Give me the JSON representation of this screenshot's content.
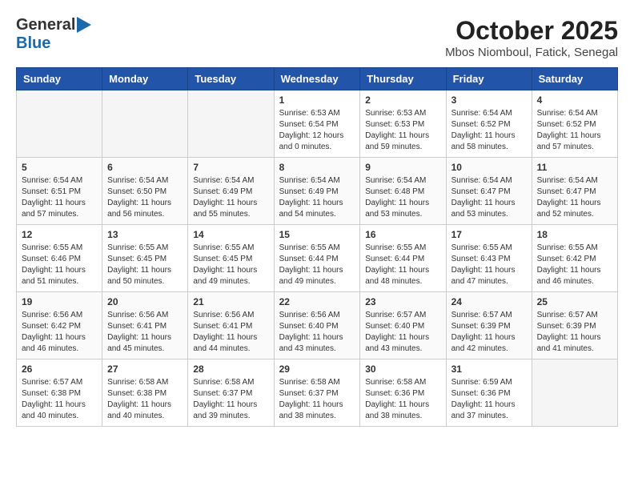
{
  "header": {
    "logo_general": "General",
    "logo_blue": "Blue",
    "title": "October 2025",
    "subtitle": "Mbos Niomboul, Fatick, Senegal"
  },
  "calendar": {
    "days_of_week": [
      "Sunday",
      "Monday",
      "Tuesday",
      "Wednesday",
      "Thursday",
      "Friday",
      "Saturday"
    ],
    "weeks": [
      [
        {
          "day": "",
          "info": ""
        },
        {
          "day": "",
          "info": ""
        },
        {
          "day": "",
          "info": ""
        },
        {
          "day": "1",
          "info": "Sunrise: 6:53 AM\nSunset: 6:54 PM\nDaylight: 12 hours\nand 0 minutes."
        },
        {
          "day": "2",
          "info": "Sunrise: 6:53 AM\nSunset: 6:53 PM\nDaylight: 11 hours\nand 59 minutes."
        },
        {
          "day": "3",
          "info": "Sunrise: 6:54 AM\nSunset: 6:52 PM\nDaylight: 11 hours\nand 58 minutes."
        },
        {
          "day": "4",
          "info": "Sunrise: 6:54 AM\nSunset: 6:52 PM\nDaylight: 11 hours\nand 57 minutes."
        }
      ],
      [
        {
          "day": "5",
          "info": "Sunrise: 6:54 AM\nSunset: 6:51 PM\nDaylight: 11 hours\nand 57 minutes."
        },
        {
          "day": "6",
          "info": "Sunrise: 6:54 AM\nSunset: 6:50 PM\nDaylight: 11 hours\nand 56 minutes."
        },
        {
          "day": "7",
          "info": "Sunrise: 6:54 AM\nSunset: 6:49 PM\nDaylight: 11 hours\nand 55 minutes."
        },
        {
          "day": "8",
          "info": "Sunrise: 6:54 AM\nSunset: 6:49 PM\nDaylight: 11 hours\nand 54 minutes."
        },
        {
          "day": "9",
          "info": "Sunrise: 6:54 AM\nSunset: 6:48 PM\nDaylight: 11 hours\nand 53 minutes."
        },
        {
          "day": "10",
          "info": "Sunrise: 6:54 AM\nSunset: 6:47 PM\nDaylight: 11 hours\nand 53 minutes."
        },
        {
          "day": "11",
          "info": "Sunrise: 6:54 AM\nSunset: 6:47 PM\nDaylight: 11 hours\nand 52 minutes."
        }
      ],
      [
        {
          "day": "12",
          "info": "Sunrise: 6:55 AM\nSunset: 6:46 PM\nDaylight: 11 hours\nand 51 minutes."
        },
        {
          "day": "13",
          "info": "Sunrise: 6:55 AM\nSunset: 6:45 PM\nDaylight: 11 hours\nand 50 minutes."
        },
        {
          "day": "14",
          "info": "Sunrise: 6:55 AM\nSunset: 6:45 PM\nDaylight: 11 hours\nand 49 minutes."
        },
        {
          "day": "15",
          "info": "Sunrise: 6:55 AM\nSunset: 6:44 PM\nDaylight: 11 hours\nand 49 minutes."
        },
        {
          "day": "16",
          "info": "Sunrise: 6:55 AM\nSunset: 6:44 PM\nDaylight: 11 hours\nand 48 minutes."
        },
        {
          "day": "17",
          "info": "Sunrise: 6:55 AM\nSunset: 6:43 PM\nDaylight: 11 hours\nand 47 minutes."
        },
        {
          "day": "18",
          "info": "Sunrise: 6:55 AM\nSunset: 6:42 PM\nDaylight: 11 hours\nand 46 minutes."
        }
      ],
      [
        {
          "day": "19",
          "info": "Sunrise: 6:56 AM\nSunset: 6:42 PM\nDaylight: 11 hours\nand 46 minutes."
        },
        {
          "day": "20",
          "info": "Sunrise: 6:56 AM\nSunset: 6:41 PM\nDaylight: 11 hours\nand 45 minutes."
        },
        {
          "day": "21",
          "info": "Sunrise: 6:56 AM\nSunset: 6:41 PM\nDaylight: 11 hours\nand 44 minutes."
        },
        {
          "day": "22",
          "info": "Sunrise: 6:56 AM\nSunset: 6:40 PM\nDaylight: 11 hours\nand 43 minutes."
        },
        {
          "day": "23",
          "info": "Sunrise: 6:57 AM\nSunset: 6:40 PM\nDaylight: 11 hours\nand 43 minutes."
        },
        {
          "day": "24",
          "info": "Sunrise: 6:57 AM\nSunset: 6:39 PM\nDaylight: 11 hours\nand 42 minutes."
        },
        {
          "day": "25",
          "info": "Sunrise: 6:57 AM\nSunset: 6:39 PM\nDaylight: 11 hours\nand 41 minutes."
        }
      ],
      [
        {
          "day": "26",
          "info": "Sunrise: 6:57 AM\nSunset: 6:38 PM\nDaylight: 11 hours\nand 40 minutes."
        },
        {
          "day": "27",
          "info": "Sunrise: 6:58 AM\nSunset: 6:38 PM\nDaylight: 11 hours\nand 40 minutes."
        },
        {
          "day": "28",
          "info": "Sunrise: 6:58 AM\nSunset: 6:37 PM\nDaylight: 11 hours\nand 39 minutes."
        },
        {
          "day": "29",
          "info": "Sunrise: 6:58 AM\nSunset: 6:37 PM\nDaylight: 11 hours\nand 38 minutes."
        },
        {
          "day": "30",
          "info": "Sunrise: 6:58 AM\nSunset: 6:36 PM\nDaylight: 11 hours\nand 38 minutes."
        },
        {
          "day": "31",
          "info": "Sunrise: 6:59 AM\nSunset: 6:36 PM\nDaylight: 11 hours\nand 37 minutes."
        },
        {
          "day": "",
          "info": ""
        }
      ]
    ]
  }
}
